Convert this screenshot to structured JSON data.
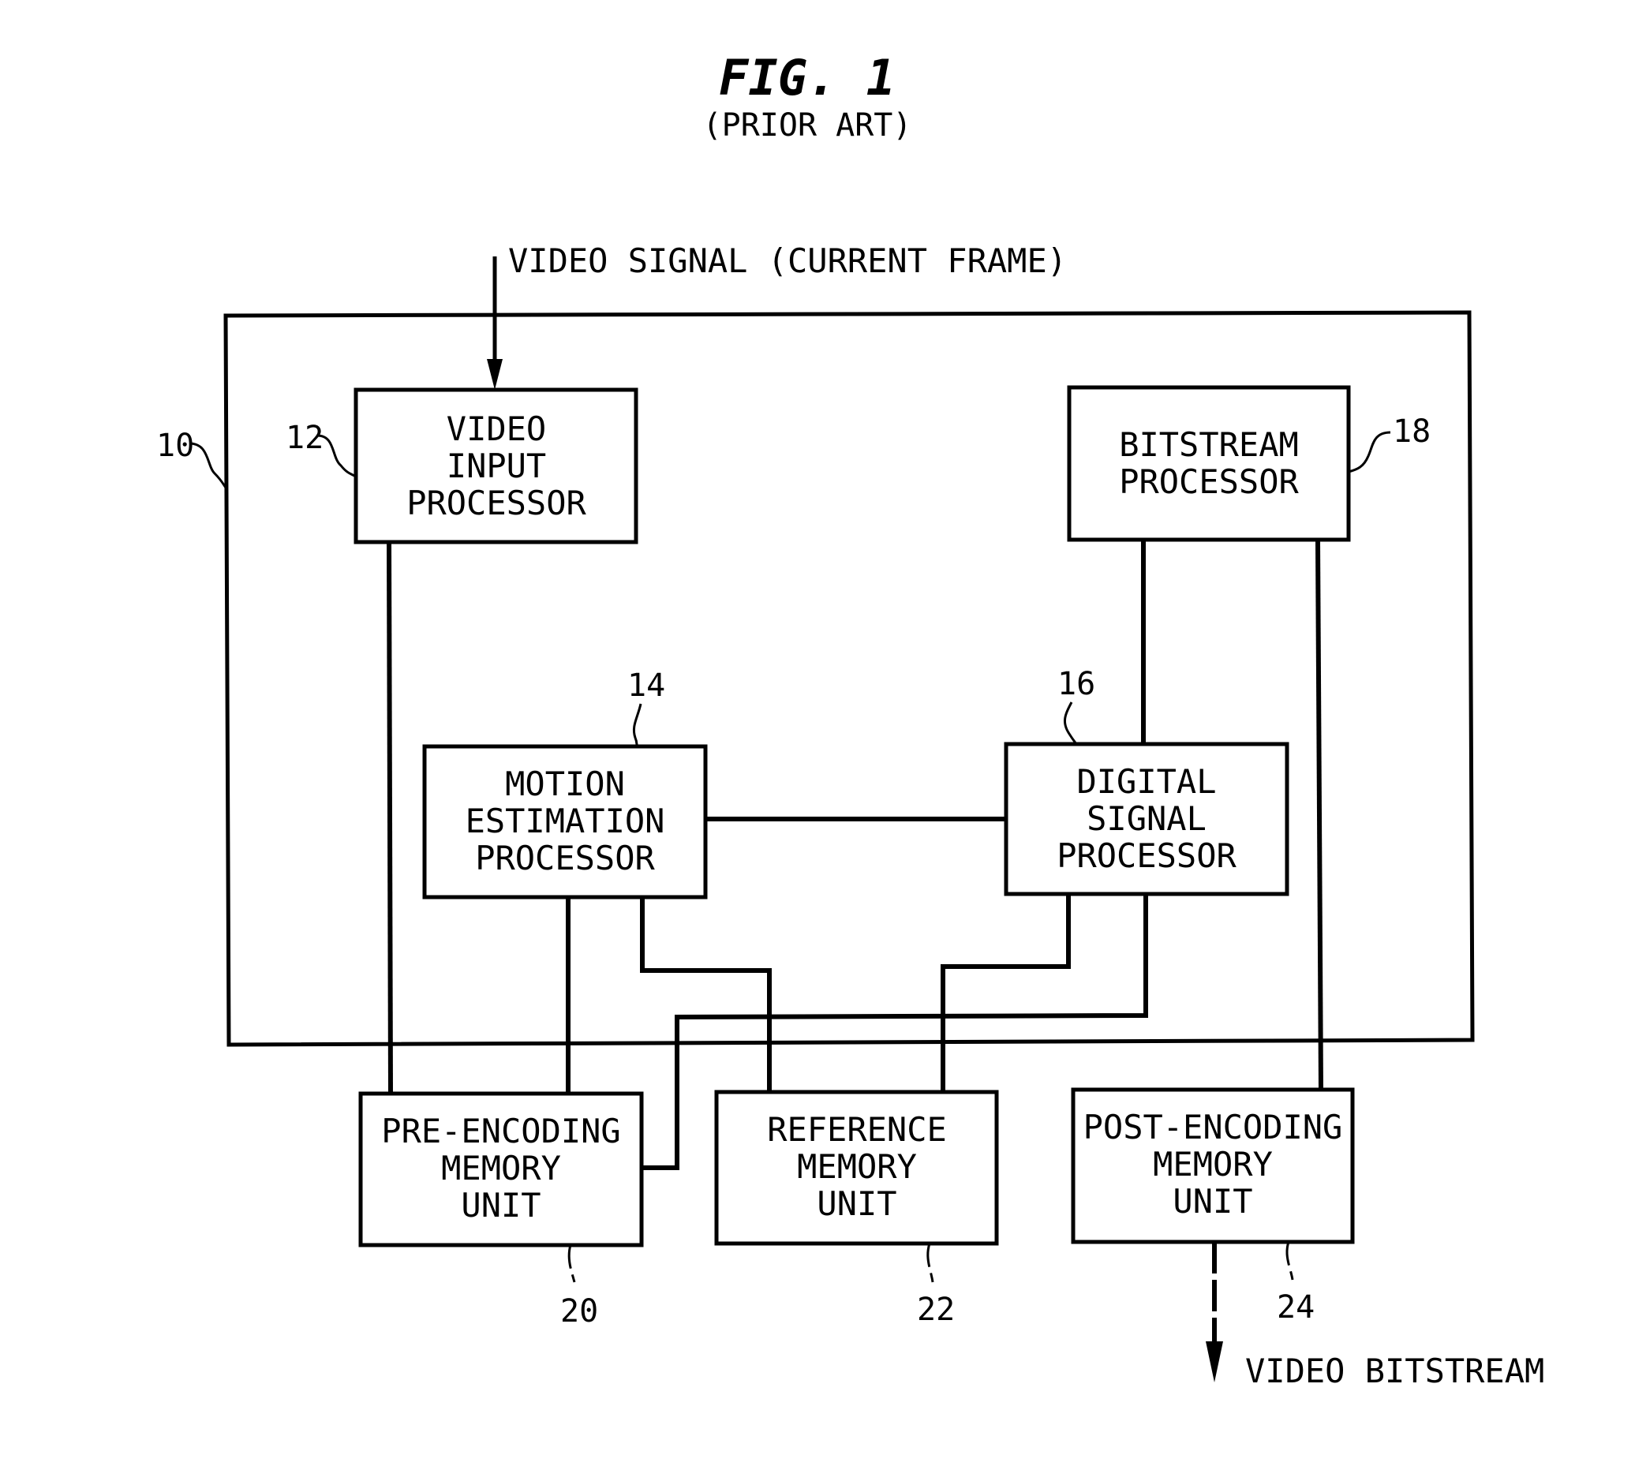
{
  "figure": {
    "title": "FIG. 1",
    "subtitle": "(PRIOR ART)"
  },
  "input_label": "VIDEO SIGNAL (CURRENT FRAME)",
  "output_label": "VIDEO BITSTREAM",
  "system": {
    "ref": "10"
  },
  "blocks": {
    "video_input": {
      "ref": "12",
      "lines": [
        "VIDEO",
        "INPUT",
        "PROCESSOR"
      ]
    },
    "motion_estimation": {
      "ref": "14",
      "lines": [
        "MOTION",
        "ESTIMATION",
        "PROCESSOR"
      ]
    },
    "digital_signal": {
      "ref": "16",
      "lines": [
        "DIGITAL",
        "SIGNAL",
        "PROCESSOR"
      ]
    },
    "bitstream": {
      "ref": "18",
      "lines": [
        "BITSTREAM",
        "PROCESSOR"
      ]
    },
    "pre_encoding": {
      "ref": "20",
      "lines": [
        "PRE-ENCODING",
        "MEMORY",
        "UNIT"
      ]
    },
    "reference": {
      "ref": "22",
      "lines": [
        "REFERENCE",
        "MEMORY",
        "UNIT"
      ]
    },
    "post_encoding": {
      "ref": "24",
      "lines": [
        "POST-ENCODING",
        "MEMORY",
        "UNIT"
      ]
    }
  }
}
